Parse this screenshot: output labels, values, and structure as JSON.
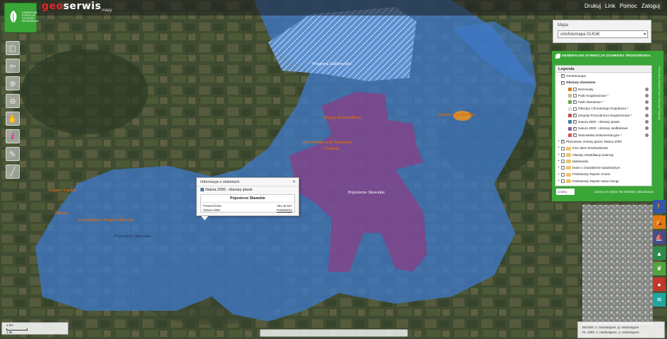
{
  "brand": {
    "part1": "geo",
    "part2": "serwis",
    "sub": "mapy"
  },
  "logo_lines": [
    "GENERALNA",
    "DYREKCJA",
    "OCHRONY",
    "ŚRODOWISKA"
  ],
  "top_menu": [
    "Drukuj",
    "Link",
    "Pomoc",
    "Zaloguj"
  ],
  "tools": [
    {
      "icon": "pan-icon",
      "glyph": "▢"
    },
    {
      "icon": "back-arrow-icon",
      "glyph": "⇦"
    },
    {
      "icon": "zoom-in-icon",
      "glyph": "⊕"
    },
    {
      "icon": "zoom-out-icon",
      "glyph": "⊖"
    },
    {
      "icon": "hand-icon",
      "glyph": "✋"
    },
    {
      "icon": "info-icon",
      "glyph": "i"
    },
    {
      "icon": "measure-line-icon",
      "glyph": "✎"
    },
    {
      "icon": "ruler-icon",
      "glyph": "╱"
    }
  ],
  "mapa_panel": {
    "title": "Mapa",
    "selected": "ortofotomapa GUGiK"
  },
  "gdos_panel": {
    "title": "GENERALNA DYREKCJA OCHRONY ŚRODOWISKA",
    "side_label": "Generalny Rejestr Form Ochrony Przyrody",
    "legend_title": "Legenda",
    "rows": [
      {
        "indent": 0,
        "type": "check",
        "checked": true,
        "label": "Ortofotomapa",
        "expander": "-"
      },
      {
        "indent": 0,
        "type": "check",
        "checked": true,
        "label": "Obszary chronione",
        "expander": "-",
        "bold": true
      },
      {
        "indent": 1,
        "type": "layer",
        "checked": false,
        "label": "Rezerwaty",
        "swatch": "#e07a1f"
      },
      {
        "indent": 1,
        "type": "layer",
        "checked": false,
        "label": "Parki Krajobrazowe *",
        "swatch": "#c9b98a"
      },
      {
        "indent": 1,
        "type": "layer",
        "checked": true,
        "label": "Parki Narodowe *",
        "swatch": "#6aa84f"
      },
      {
        "indent": 1,
        "type": "layer",
        "checked": false,
        "label": "Obszary Chronionego Krajobrazu *",
        "swatch": "#dddddd"
      },
      {
        "indent": 1,
        "type": "layer",
        "checked": true,
        "label": "Zespoły Przyrodniczo-Krajobrazowe *",
        "swatch": "#c0504d"
      },
      {
        "indent": 1,
        "type": "layer",
        "checked": true,
        "label": "Natura 2000 - obszary ptasie",
        "swatch": "#4a78b5"
      },
      {
        "indent": 1,
        "type": "layer",
        "checked": true,
        "label": "Natura 2000 - obszary siedliskowe",
        "swatch": "#8e5a9e"
      },
      {
        "indent": 1,
        "type": "layer",
        "checked": true,
        "label": "Stanowiska Dokumentacyjne *",
        "swatch": "#d9534f"
      },
      {
        "indent": 0,
        "type": "check",
        "checked": true,
        "label": "Planowane zmiany granic Natura 2000",
        "expander": "+"
      },
      {
        "indent": 0,
        "type": "folder",
        "label": "Inne dane środowiskowe",
        "expander": "+"
      },
      {
        "indent": 0,
        "type": "folder",
        "label": "Obiekty rehabilitacji zwierząt",
        "expander": "+"
      },
      {
        "indent": 0,
        "type": "folder",
        "label": "Multimedia",
        "expander": "+"
      },
      {
        "indent": 0,
        "type": "folder",
        "label": "Dane o charakterze katastralnym",
        "expander": "+"
      },
      {
        "indent": 0,
        "type": "folder",
        "label": "Państwowy Rejestr Granic",
        "expander": "+"
      },
      {
        "indent": 0,
        "type": "folder",
        "label": "Państwowy Rejestr Nazw Geogr.",
        "expander": "+"
      }
    ],
    "search_label": "szukaj",
    "footer": "Zaznacz w obszar dla obiektów | aktualizacja"
  },
  "right_icons": [
    {
      "name": "hiking-icon",
      "glyph": "🚶",
      "color": "#3157a6"
    },
    {
      "name": "tent-icon",
      "glyph": "⛺",
      "color": "#e27a14"
    },
    {
      "name": "boat-icon",
      "glyph": "⛵",
      "color": "#4a4a8c"
    },
    {
      "name": "tree-icon",
      "glyph": "▲",
      "color": "#2d8a4b"
    },
    {
      "name": "leaf-icon",
      "glyph": "❦",
      "color": "#55a33c"
    },
    {
      "name": "mushroom-icon",
      "glyph": "●",
      "color": "#c4352a"
    },
    {
      "name": "water-icon",
      "glyph": "≋",
      "color": "#1ea7a1"
    }
  ],
  "popup": {
    "title": "Informacja o obiektach",
    "layer": "Natura 2000 - obszary ptasie",
    "object_name": "Pojezierze Sławskie",
    "k1": "Powierzchnia",
    "v1": "261,45 km²",
    "k2": "Natura 2000",
    "v2": "PLB080011"
  },
  "map_labels": [
    {
      "text": "Wzgórza Dalkowskie",
      "cls": "mlabel-w"
    },
    {
      "text": "Wyspa Konradowa",
      "cls": "mlabel"
    },
    {
      "text": "Jezioro Tarnowskie",
      "cls": "mlabel"
    },
    {
      "text": "Torfowisko nad Jeziorem",
      "cls": "mlabel"
    },
    {
      "text": "Ciekiem",
      "cls": "mlabel"
    },
    {
      "text": "Pojezierze Sławskie",
      "cls": "mlabel-w"
    },
    {
      "text": "Jezioro Łuskie",
      "cls": "mlabel"
    },
    {
      "text": "Mesze",
      "cls": "mlabel"
    },
    {
      "text": "Jarzebinowe Bagno Sławskie",
      "cls": "mlabel"
    },
    {
      "text": "Pojezierze Sławskie",
      "cls": "mlabel-b"
    }
  ],
  "scale": {
    "label1": "1 km",
    "label2": "1:5k"
  },
  "coords": {
    "line1": "WGS84: λ: niedostępne, φ: niedostępne",
    "line2": "PL-1992: x: niedostępne, y: niedostępne"
  }
}
